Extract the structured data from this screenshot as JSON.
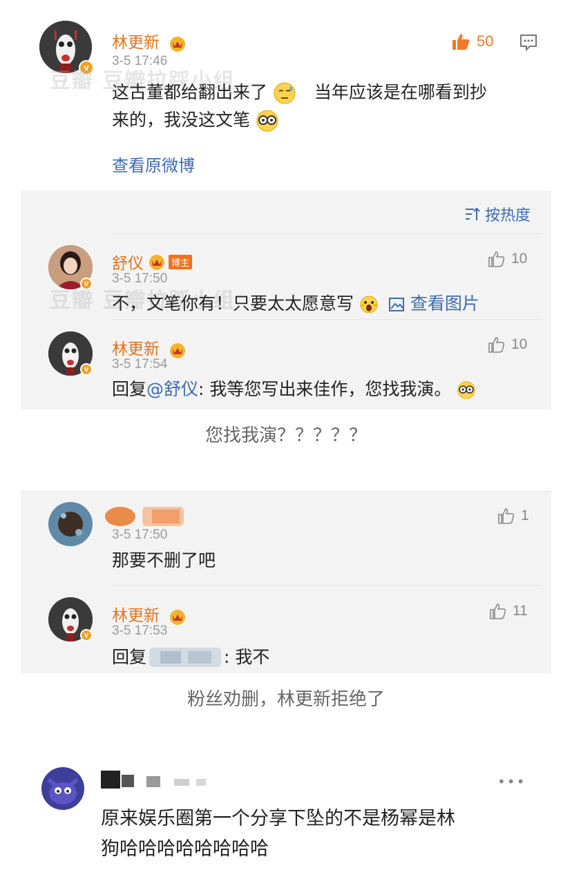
{
  "main_post": {
    "author": "林更新",
    "time": "3-5 17:46",
    "likes": "50",
    "text_part1": "这古董都给翻出来了",
    "text_part2": "当年应该是在哪看到抄",
    "text_part3": "来的，我没这文笔",
    "view_original": "查看原微博"
  },
  "replies_panel_1": {
    "sort_label": "按热度",
    "comments": [
      {
        "author": "舒仪",
        "tag": "博主",
        "time": "3-5 17:50",
        "likes": "10",
        "text": "不，文笔你有！只要太太愿意写",
        "view_image": "查看图片"
      },
      {
        "author": "林更新",
        "time": "3-5 17:54",
        "likes": "10",
        "reply_prefix": "回复",
        "mention": "@舒仪",
        "text": ": 我等您写出来佳作，您找我演。"
      }
    ]
  },
  "caption_1": "您找我演？？？？？",
  "replies_panel_2": {
    "comments": [
      {
        "time": "3-5 17:50",
        "likes": "1",
        "text": "那要不删了吧"
      },
      {
        "author": "林更新",
        "time": "3-5 17:53",
        "likes": "11",
        "reply_prefix": "回复",
        "text": ": 我不"
      }
    ]
  },
  "caption_2": "粉丝劝删，林更新拒绝了",
  "bottom_comment": {
    "more": "•••",
    "text_line1": "原来娱乐圈第一个分享下坠的不是杨幂是林",
    "text_line2": "狗哈哈哈哈哈哈哈哈"
  },
  "watermark_text": "豆瓣 豆瓣拉踩小组",
  "colors": {
    "name": "#e2741e",
    "link": "#3c6cb3",
    "panel_bg": "#f3f3f3",
    "like_active": "#f07a2a"
  }
}
